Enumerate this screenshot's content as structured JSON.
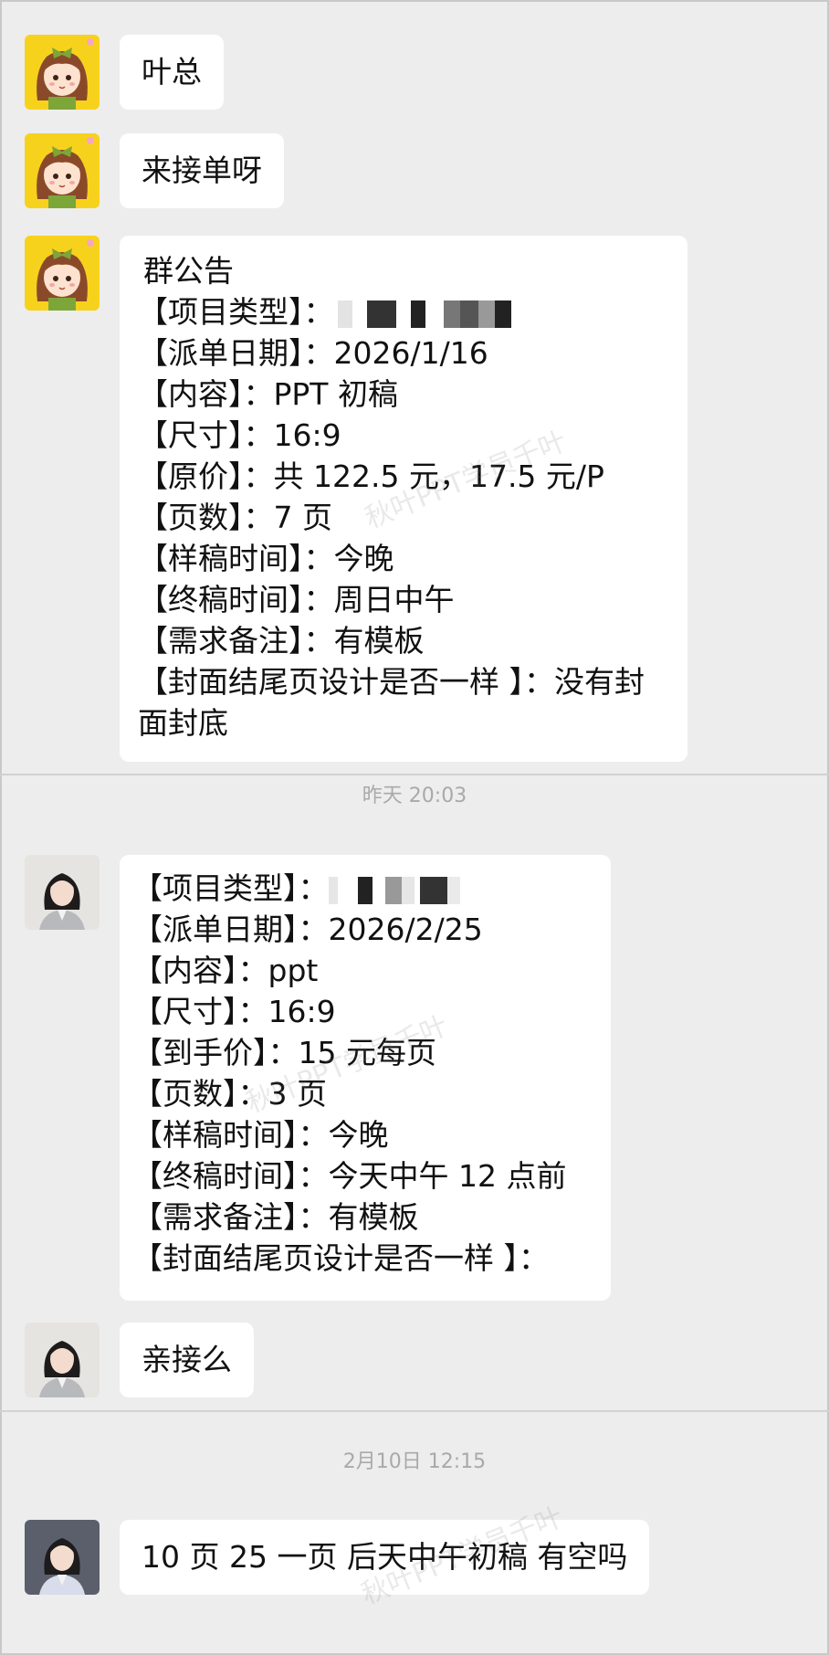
{
  "colors": {
    "background": "#ededed",
    "bubble": "#ffffff",
    "timestamp_text": "#a9a9a9",
    "avatar_cartoon_bg": "#f7d21c"
  },
  "messages": [
    {
      "sender_avatar": "cartoon-girl-avatar",
      "text": "叶总"
    },
    {
      "sender_avatar": "cartoon-girl-avatar",
      "text": "来接单呀"
    },
    {
      "sender_avatar": "cartoon-girl-avatar",
      "lines": [
        "群公告",
        "【项目类型】：",
        "【派单日期】：2026/1/16",
        "【内容】：PPT 初稿",
        "【尺寸】：16:9",
        "【原价】：共 122.5 元，17.5 元/P",
        "【页数】：7 页",
        "【样稿时间】：今晚",
        "【终稿时间】：周日中午",
        "【需求备注】：有模板",
        "【封面结尾页设计是否一样 】：没有封面封底"
      ]
    }
  ],
  "timestamp_1": "昨天 20:03",
  "messages_2": [
    {
      "sender_avatar": "woman-photo-avatar",
      "lines": [
        "【项目类型】：",
        "【派单日期】：2026/2/25",
        "【内容】：ppt",
        "【尺寸】：16:9",
        "【到手价】：15 元每页",
        "【页数】：3 页",
        "【样稿时间】：今晚",
        "【终稿时间】：今天中午 12 点前",
        "【需求备注】：有模板",
        "【封面结尾页设计是否一样 】："
      ]
    },
    {
      "sender_avatar": "woman-photo-avatar",
      "text": "亲接么"
    }
  ],
  "timestamp_2": "2月10日 12:15",
  "messages_3": [
    {
      "sender_avatar": "woman-photo-avatar",
      "text": "10 页 25 一页 后天中午初稿 有空吗"
    }
  ],
  "watermark_text": "秋叶PPT学员千叶"
}
